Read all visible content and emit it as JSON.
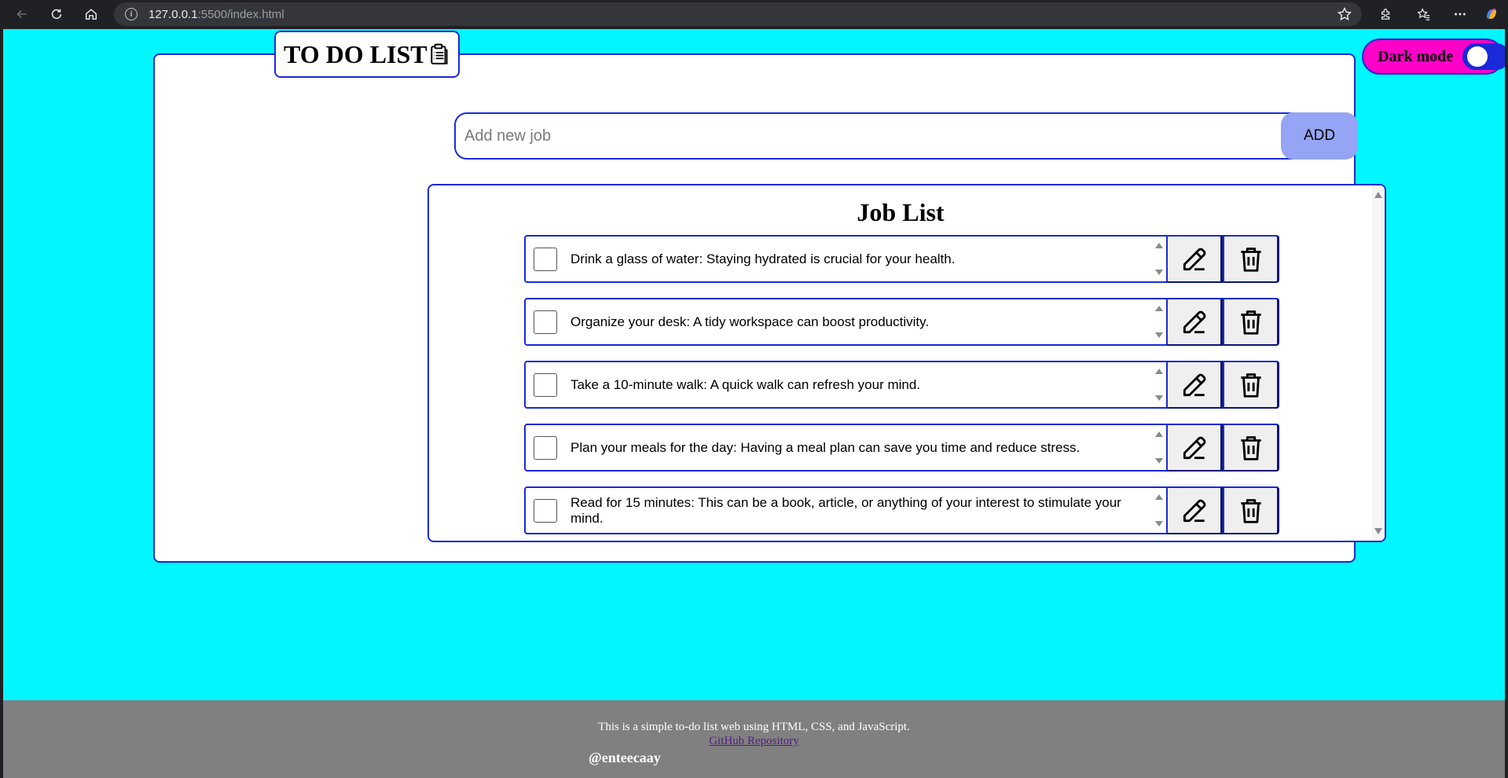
{
  "browser": {
    "url_host": "127.0.0.1",
    "url_rest": ":5500/index.html"
  },
  "app": {
    "title": "TO DO LIST",
    "add_placeholder": "Add new job",
    "add_button": "ADD",
    "list_title": "Job List",
    "dark_mode_label": "Dark mode",
    "dark_mode_on": false,
    "jobs": [
      {
        "text": "Drink a glass of water: Staying hydrated is crucial for your health.",
        "checked": false
      },
      {
        "text": "Organize your desk: A tidy workspace can boost productivity.",
        "checked": false
      },
      {
        "text": "Take a 10-minute walk: A quick walk can refresh your mind.",
        "checked": false
      },
      {
        "text": "Plan your meals for the day: Having a meal plan can save you time and reduce stress.",
        "checked": false
      },
      {
        "text": "Read for 15 minutes: This can be a book, article, or anything of your interest to stimulate your mind.",
        "checked": false
      }
    ]
  },
  "footer": {
    "description": "This is a simple to-do list web using HTML, CSS, and JavaScript.",
    "link_text": "GitHub Repository",
    "handle": "@enteecaay"
  },
  "colors": {
    "page_bg": "#00f7ff",
    "border": "#1a2ad8",
    "add_button": "#95a4f4",
    "toggle_bg": "#ff00c8",
    "footer_bg": "#808080"
  }
}
